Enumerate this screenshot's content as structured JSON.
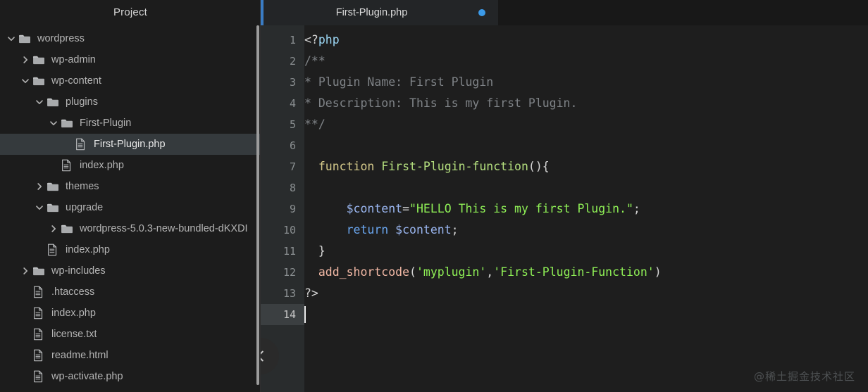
{
  "sidebar": {
    "title": "Project",
    "tree": [
      {
        "label": "wordpress",
        "type": "folder",
        "depth": 0,
        "state": "expanded",
        "selected": false
      },
      {
        "label": "wp-admin",
        "type": "folder",
        "depth": 1,
        "state": "collapsed",
        "selected": false
      },
      {
        "label": "wp-content",
        "type": "folder",
        "depth": 1,
        "state": "expanded",
        "selected": false
      },
      {
        "label": "plugins",
        "type": "folder",
        "depth": 2,
        "state": "expanded",
        "selected": false
      },
      {
        "label": "First-Plugin",
        "type": "folder",
        "depth": 3,
        "state": "expanded",
        "selected": false
      },
      {
        "label": "First-Plugin.php",
        "type": "file",
        "depth": 4,
        "state": "none",
        "selected": true
      },
      {
        "label": "index.php",
        "type": "file",
        "depth": 3,
        "state": "none",
        "selected": false
      },
      {
        "label": "themes",
        "type": "folder",
        "depth": 2,
        "state": "collapsed",
        "selected": false
      },
      {
        "label": "upgrade",
        "type": "folder",
        "depth": 2,
        "state": "expanded",
        "selected": false
      },
      {
        "label": "wordpress-5.0.3-new-bundled-dKXDI",
        "type": "folder",
        "depth": 3,
        "state": "collapsed",
        "selected": false
      },
      {
        "label": "index.php",
        "type": "file",
        "depth": 2,
        "state": "none",
        "selected": false
      },
      {
        "label": "wp-includes",
        "type": "folder",
        "depth": 1,
        "state": "collapsed",
        "selected": false
      },
      {
        "label": ".htaccess",
        "type": "file",
        "depth": 1,
        "state": "none",
        "selected": false
      },
      {
        "label": "index.php",
        "type": "file",
        "depth": 1,
        "state": "none",
        "selected": false
      },
      {
        "label": "license.txt",
        "type": "file",
        "depth": 1,
        "state": "none",
        "selected": false
      },
      {
        "label": "readme.html",
        "type": "file",
        "depth": 1,
        "state": "none",
        "selected": false
      },
      {
        "label": "wp-activate.php",
        "type": "file",
        "depth": 1,
        "state": "none",
        "selected": false
      }
    ]
  },
  "editor": {
    "tab": {
      "label": "First-Plugin.php",
      "modified_dot": true
    },
    "collapse_icon": "chevron-left-icon",
    "active_line": 14,
    "line_numbers": [
      "1",
      "2",
      "3",
      "4",
      "5",
      "6",
      "7",
      "8",
      "9",
      "10",
      "11",
      "12",
      "13",
      "14"
    ],
    "lines": [
      {
        "n": 1,
        "tokens": [
          {
            "t": "<?",
            "c": "c-plain"
          },
          {
            "t": "php",
            "c": "c-php"
          }
        ]
      },
      {
        "n": 2,
        "tokens": [
          {
            "t": "/**",
            "c": "c-comment"
          }
        ]
      },
      {
        "n": 3,
        "tokens": [
          {
            "t": "* Plugin Name: First Plugin",
            "c": "c-comment"
          }
        ]
      },
      {
        "n": 4,
        "tokens": [
          {
            "t": "* Description: This is my first Plugin.",
            "c": "c-comment"
          }
        ]
      },
      {
        "n": 5,
        "tokens": [
          {
            "t": "**/",
            "c": "c-comment"
          }
        ]
      },
      {
        "n": 6,
        "tokens": []
      },
      {
        "n": 7,
        "tokens": [
          {
            "t": "  ",
            "c": "c-plain"
          },
          {
            "t": "function",
            "c": "c-kw"
          },
          {
            "t": " ",
            "c": "c-plain"
          },
          {
            "t": "First-Plugin-function",
            "c": "c-fname"
          },
          {
            "t": "(){",
            "c": "c-punct"
          }
        ]
      },
      {
        "n": 8,
        "tokens": []
      },
      {
        "n": 9,
        "tokens": [
          {
            "t": "      ",
            "c": "c-plain"
          },
          {
            "t": "$content",
            "c": "c-var"
          },
          {
            "t": "=",
            "c": "c-punct"
          },
          {
            "t": "\"HELLO This is my first Plugin.\"",
            "c": "c-str"
          },
          {
            "t": ";",
            "c": "c-punct"
          }
        ]
      },
      {
        "n": 10,
        "tokens": [
          {
            "t": "      ",
            "c": "c-plain"
          },
          {
            "t": "return",
            "c": "c-kw2"
          },
          {
            "t": " ",
            "c": "c-plain"
          },
          {
            "t": "$content",
            "c": "c-var"
          },
          {
            "t": ";",
            "c": "c-punct"
          }
        ]
      },
      {
        "n": 11,
        "tokens": [
          {
            "t": "  }",
            "c": "c-punct"
          }
        ]
      },
      {
        "n": 12,
        "tokens": [
          {
            "t": "  ",
            "c": "c-plain"
          },
          {
            "t": "add_shortcode",
            "c": "c-call"
          },
          {
            "t": "(",
            "c": "c-punct"
          },
          {
            "t": "'myplugin'",
            "c": "c-str"
          },
          {
            "t": ",",
            "c": "c-punct"
          },
          {
            "t": "'First-Plugin-Function'",
            "c": "c-str"
          },
          {
            "t": ")",
            "c": "c-punct"
          }
        ]
      },
      {
        "n": 13,
        "tokens": [
          {
            "t": "?>",
            "c": "c-plain"
          }
        ]
      },
      {
        "n": 14,
        "tokens": []
      }
    ]
  },
  "watermark": {
    "text": "@稀土掘金技术社区"
  },
  "colors": {
    "sidebar_bg": "#1c1c1c",
    "editor_bg": "#1e1e1e",
    "gutter_bg": "#292c2d",
    "tab_bg": "#232527",
    "tab_accent": "#3a7cc4",
    "modified_dot": "#3b9ae8",
    "selection_bg": "#353a3d",
    "comment": "#7f8387",
    "string": "#8ff056",
    "keyword": "#d4c98a",
    "return_kw": "#6aa6ef",
    "function_name": "#b5e07f",
    "variable": "#9ab6f0",
    "function_call": "#f3b9a6"
  }
}
